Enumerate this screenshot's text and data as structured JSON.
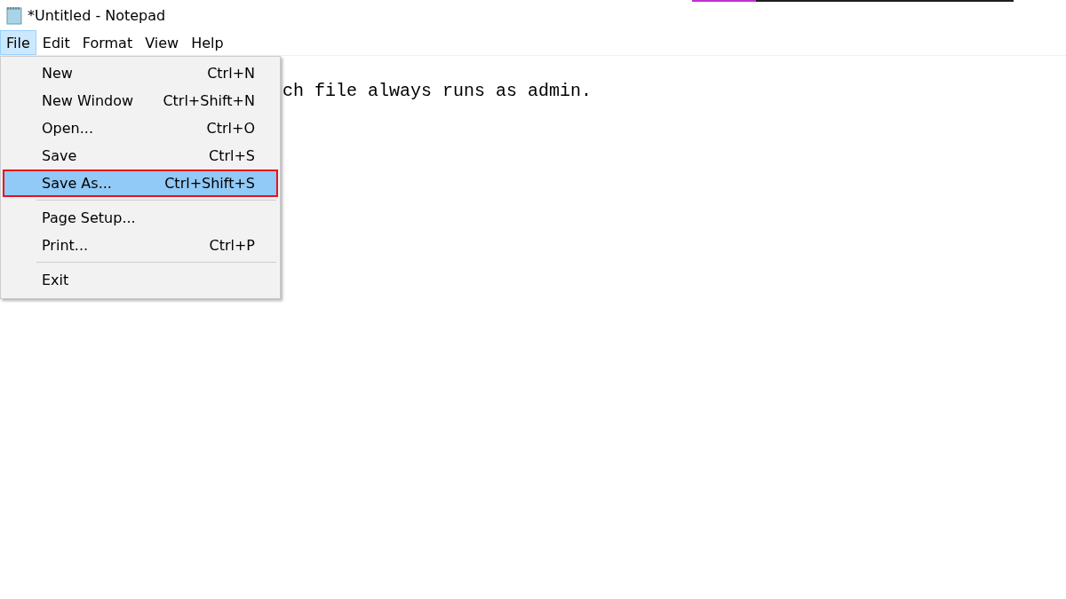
{
  "window": {
    "title": "*Untitled - Notepad"
  },
  "menu_bar": [
    {
      "label": "File",
      "selected": true
    },
    {
      "label": "Edit",
      "selected": false
    },
    {
      "label": "Format",
      "selected": false
    },
    {
      "label": "View",
      "selected": false
    },
    {
      "label": "Help",
      "selected": false
    }
  ],
  "editor": {
    "visible_text": "ch file always runs as admin."
  },
  "file_menu": [
    {
      "kind": "item",
      "label": "New",
      "shortcut": "Ctrl+N",
      "selected": false
    },
    {
      "kind": "item",
      "label": "New Window",
      "shortcut": "Ctrl+Shift+N",
      "selected": false
    },
    {
      "kind": "item",
      "label": "Open...",
      "shortcut": "Ctrl+O",
      "selected": false
    },
    {
      "kind": "item",
      "label": "Save",
      "shortcut": "Ctrl+S",
      "selected": false
    },
    {
      "kind": "item",
      "label": "Save As...",
      "shortcut": "Ctrl+Shift+S",
      "selected": true
    },
    {
      "kind": "separator"
    },
    {
      "kind": "item",
      "label": "Page Setup...",
      "selected": false
    },
    {
      "kind": "item",
      "label": "Print...",
      "shortcut": "Ctrl+P",
      "selected": false
    },
    {
      "kind": "separator"
    },
    {
      "kind": "item",
      "label": "Exit",
      "selected": false
    }
  ]
}
